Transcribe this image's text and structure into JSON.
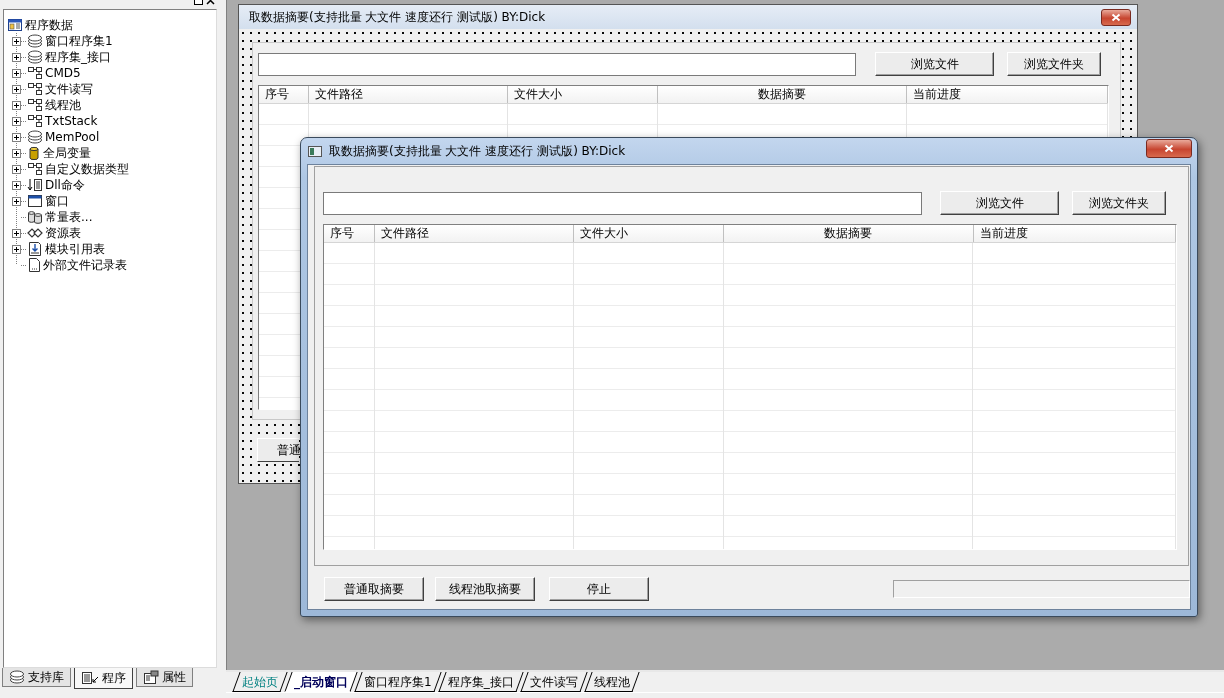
{
  "left_panel": {
    "tree": {
      "label": "程序数据",
      "children": [
        {
          "label": "窗口程序集1",
          "kind": "branch"
        },
        {
          "label": "程序集_接口",
          "kind": "branch"
        },
        {
          "label": "CMD5",
          "kind": "branch"
        },
        {
          "label": "文件读写",
          "kind": "branch"
        },
        {
          "label": "线程池",
          "kind": "branch"
        },
        {
          "label": "TxtStack",
          "kind": "branch"
        },
        {
          "label": "MemPool",
          "kind": "branch"
        },
        {
          "label": "全局变量",
          "kind": "branch"
        },
        {
          "label": "自定义数据类型",
          "kind": "branch"
        },
        {
          "label": "Dll命令",
          "kind": "branch"
        },
        {
          "label": "窗口",
          "kind": "branch"
        },
        {
          "label": "常量表...",
          "kind": "leaf"
        },
        {
          "label": "资源表",
          "kind": "branch"
        },
        {
          "label": "模块引用表",
          "kind": "branch"
        },
        {
          "label": "外部文件记录表",
          "kind": "leaf"
        }
      ]
    },
    "tabs": [
      {
        "label": "支持库",
        "selected": false
      },
      {
        "label": "程序",
        "selected": true
      },
      {
        "label": "属性",
        "selected": false
      }
    ]
  },
  "designer_window": {
    "title": "取数据摘要(支持批量 大文件 速度还行 测试版) BY:Dick",
    "buttons": [
      "浏览文件",
      "浏览文件夹"
    ],
    "columns": [
      "序号",
      "文件路径",
      "文件大小",
      "数据摘要",
      "当前进度"
    ],
    "actions": [
      "普通"
    ]
  },
  "app_window": {
    "title": "取数据摘要(支持批量 大文件 速度还行 测试版) BY:Dick",
    "buttons": [
      "浏览文件",
      "浏览文件夹"
    ],
    "columns": [
      "序号",
      "文件路径",
      "文件大小",
      "数据摘要",
      "当前进度"
    ],
    "actions": [
      "普通取摘要",
      "线程池取摘要",
      "停止"
    ],
    "progress": {
      "level": 0
    }
  },
  "document_tabs": [
    {
      "label": "起始页",
      "kind": "start",
      "selected": false
    },
    {
      "label": "_启动窗口",
      "kind": "form",
      "selected": true
    },
    {
      "label": "窗口程序集1",
      "kind": "code",
      "selected": false
    },
    {
      "label": "程序集_接口",
      "kind": "code",
      "selected": false
    },
    {
      "label": "文件读写",
      "kind": "code",
      "selected": false
    },
    {
      "label": "线程池",
      "kind": "code",
      "selected": false
    }
  ]
}
